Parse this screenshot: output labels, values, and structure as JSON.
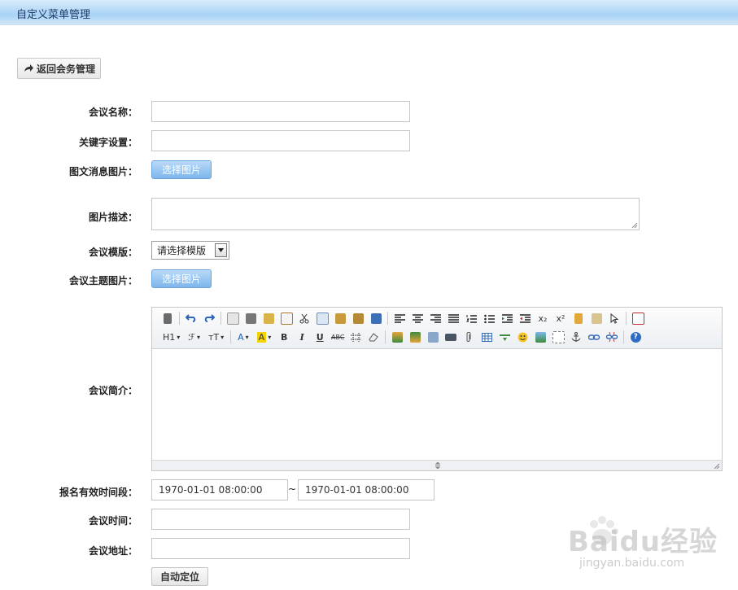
{
  "header": {
    "title": "自定义菜单管理"
  },
  "back_button": {
    "label": "返回会务管理"
  },
  "form": {
    "meeting_name_label": "会议名称：",
    "keyword_label": "关键字设置：",
    "image_msg_label": "图文消息图片：",
    "image_desc_label": "图片描述：",
    "template_label": "会议模版：",
    "theme_image_label": "会议主题图片：",
    "intro_label": "会议简介：",
    "signup_period_label": "报名有效时间段：",
    "meeting_time_label": "会议时间：",
    "meeting_address_label": "会议地址：",
    "choose_image_label": "选择图片",
    "template_select": {
      "selected": "请选择模版"
    },
    "signup_start": "1970-01-01 08:00:00",
    "signup_end": "1970-01-01 08:00:00",
    "range_separator": "~",
    "auto_locate_label": "自动定位"
  },
  "editor": {
    "toolbar_text": {
      "heading": "H1",
      "font_family": "ℱ",
      "font_size": "тT",
      "font_color": "A",
      "bg_color": "A",
      "bold": "B",
      "italic": "I",
      "underline": "U",
      "strike": "ABC",
      "subscript": "x₂",
      "superscript": "x²",
      "help": "?"
    }
  },
  "watermark": {
    "brand": "Baidu经验",
    "url": "jingyan.baidu.com"
  },
  "colors": {
    "header_gradient": "#a9d3f6",
    "choose_button": "#7db6ec",
    "header_title": "#1f3c66"
  }
}
